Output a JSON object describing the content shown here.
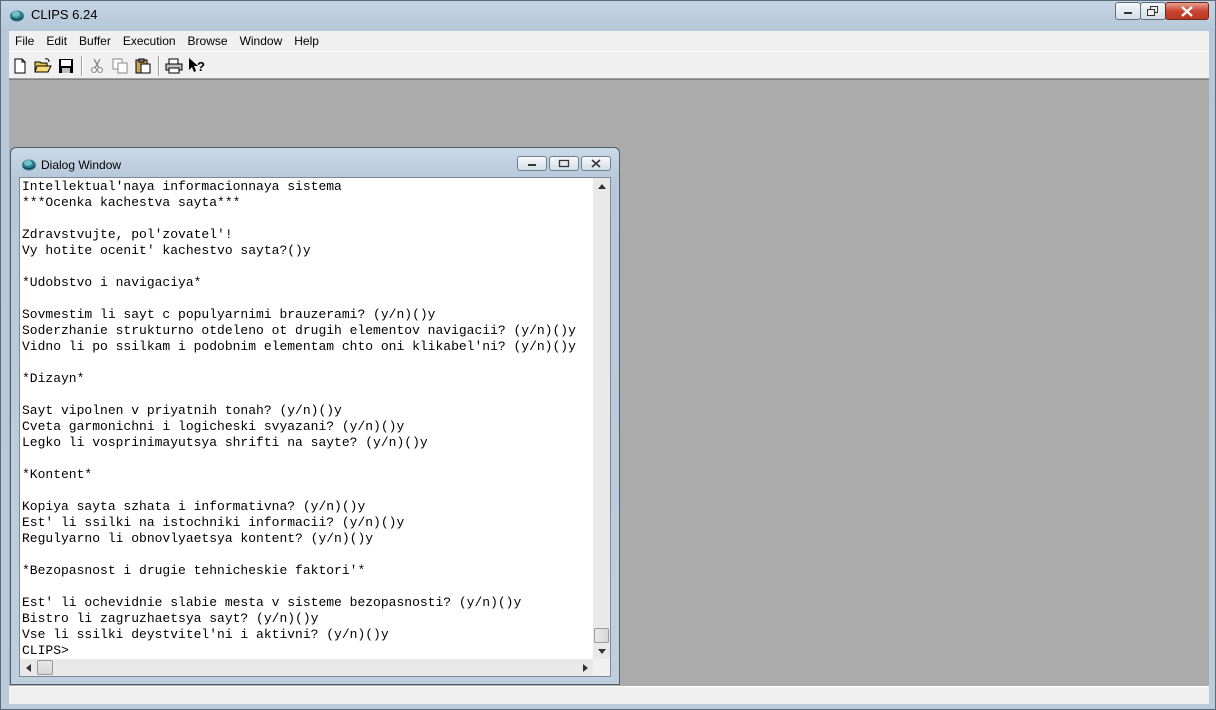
{
  "app": {
    "title": "CLIPS 6.24"
  },
  "menu": [
    "File",
    "Edit",
    "Buffer",
    "Execution",
    "Browse",
    "Window",
    "Help"
  ],
  "toolbar": {
    "buttons": [
      "new-file-icon",
      "open-folder-icon",
      "save-icon",
      "cut-icon",
      "copy-icon",
      "paste-icon",
      "print-icon",
      "context-help-icon"
    ]
  },
  "dialog": {
    "title": "Dialog Window",
    "lines": [
      "Intellektual'naya informacionnaya sistema",
      "***Ocenka kachestva sayta***",
      "",
      "Zdravstvujte, pol'zovatel'!",
      "Vy hotite ocenit' kachestvo sayta?()y",
      "",
      "*Udobstvo i navigaciya*",
      "",
      "Sovmestim li sayt c populyarnimi brauzerami? (y/n)()y",
      "Soderzhanie strukturno otdeleno ot drugih elementov navigacii? (y/n)()y",
      "Vidno li po ssilkam i podobnim elementam chto oni klikabel'ni? (y/n)()y",
      "",
      "*Dizayn*",
      "",
      "Sayt vipolnen v priyatnih tonah? (y/n)()y",
      "Cveta garmonichni i logicheski svyazani? (y/n)()y",
      "Legko li vosprinimayutsya shrifti na sayte? (y/n)()y",
      "",
      "*Kontent*",
      "",
      "Kopiya sayta szhata i informativna? (y/n)()y",
      "Est' li ssilki na istochniki informacii? (y/n)()y",
      "Regulyarno li obnovlyaetsya kontent? (y/n)()y",
      "",
      "*Bezopasnost i drugie tehnicheskie faktori'*",
      "",
      "Est' li ochevidnie slabie mesta v sisteme bezopasnosti? (y/n)()y",
      "Bistro li zagruzhaetsya sayt? (y/n)()y",
      "Vse li ssilki deystvitel'ni i aktivni? (y/n)()y",
      "CLIPS>"
    ]
  }
}
